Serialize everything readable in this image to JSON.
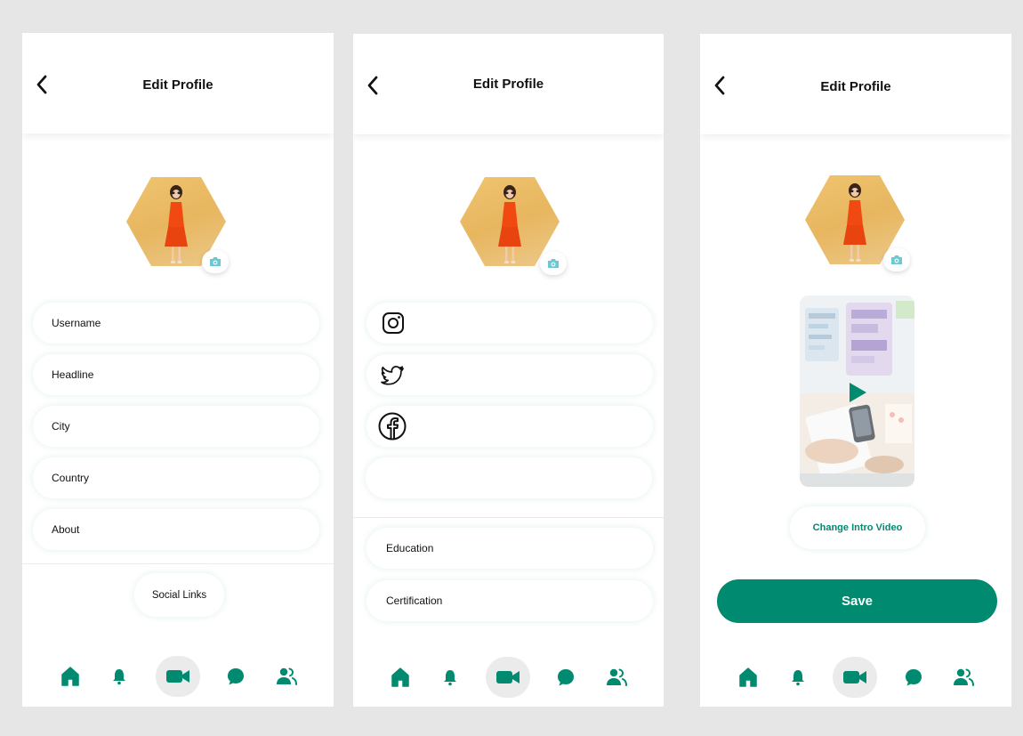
{
  "screens": [
    {
      "title": "Edit Profile",
      "fields": [
        "Username",
        "Headline",
        "City",
        "Country",
        "About"
      ],
      "social_links_label": "Social Links"
    },
    {
      "title": "Edit Profile",
      "social_fields": [
        {
          "icon": "instagram-icon"
        },
        {
          "icon": "twitter-icon"
        },
        {
          "icon": "facebook-icon"
        },
        {
          "icon": ""
        }
      ],
      "fields": [
        "Education",
        "Certification"
      ]
    },
    {
      "title": "Edit Profile",
      "change_video_label": "Change Intro Video",
      "save_label": "Save"
    }
  ],
  "nav_items": [
    "home-icon",
    "bell-icon",
    "video-icon",
    "chat-icon",
    "users-icon"
  ],
  "colors": {
    "accent": "#008a6f",
    "camera": "#6cc9d3",
    "background": "#e6e6e6"
  }
}
